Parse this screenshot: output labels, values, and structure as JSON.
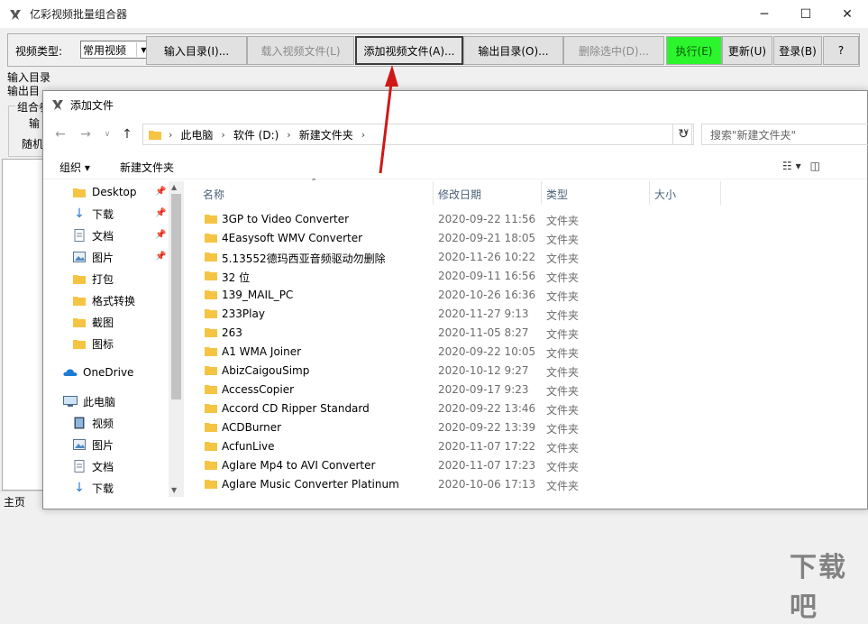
{
  "app": {
    "title": "亿彩视频批量组合器",
    "window_controls": [
      "─",
      "☐",
      "✕"
    ]
  },
  "toolbar": {
    "video_type_label": "视频类型:",
    "video_type_value": "常用视频",
    "buttons": [
      {
        "label": "输入目录(I)...",
        "state": "normal"
      },
      {
        "label": "载入视频文件(L)",
        "state": "disabled"
      },
      {
        "label": "添加视频文件(A)...",
        "state": "active"
      },
      {
        "label": "输出目录(O)...",
        "state": "normal"
      },
      {
        "label": "删除选中(D)...",
        "state": "disabled"
      },
      {
        "label": "执行(E)",
        "state": "green"
      },
      {
        "label": "更新(U)",
        "state": "normal"
      },
      {
        "label": "登录(B)",
        "state": "normal"
      },
      {
        "label": "?",
        "state": "normal"
      }
    ]
  },
  "left_panel": {
    "input_dir_label": "输入目录",
    "output_dir_label": "输出目",
    "group_title": "组合参",
    "group_line1": "输",
    "group_line2": "随机"
  },
  "status_bar": {
    "text": "主页"
  },
  "dialog": {
    "title": "添加文件",
    "breadcrumbs": [
      "此电脑",
      "软件 (D:)",
      "新建文件夹"
    ],
    "search_placeholder": "搜索\"新建文件夹\"",
    "commands": {
      "organize": "组织 ▾",
      "new_folder": "新建文件夹"
    },
    "nav_items": [
      {
        "label": "Desktop",
        "icon": "folder-icon",
        "pinned": true
      },
      {
        "label": "下载",
        "icon": "download-icon",
        "pinned": true
      },
      {
        "label": "文档",
        "icon": "document-icon",
        "pinned": true
      },
      {
        "label": "图片",
        "icon": "picture-icon",
        "pinned": true
      },
      {
        "label": "打包",
        "icon": "folder-icon",
        "pinned": false
      },
      {
        "label": "格式转换",
        "icon": "folder-icon",
        "pinned": false
      },
      {
        "label": "截图",
        "icon": "folder-icon",
        "pinned": false
      },
      {
        "label": "图标",
        "icon": "folder-icon",
        "pinned": false
      },
      {
        "label": "OneDrive",
        "icon": "cloud-icon",
        "pinned": false
      },
      {
        "label": "此电脑",
        "icon": "computer-icon",
        "pinned": false
      },
      {
        "label": "视频",
        "icon": "video-icon",
        "pinned": false
      },
      {
        "label": "图片",
        "icon": "picture-icon",
        "pinned": false
      },
      {
        "label": "文档",
        "icon": "document-icon",
        "pinned": false
      },
      {
        "label": "下载",
        "icon": "download-icon",
        "pinned": false
      }
    ],
    "columns": [
      "名称",
      "修改日期",
      "类型",
      "大小"
    ],
    "files": [
      {
        "name": "3GP to Video Converter",
        "date": "2020-09-22 11:56",
        "type": "文件夹"
      },
      {
        "name": "4Easysoft WMV Converter",
        "date": "2020-09-21 18:05",
        "type": "文件夹"
      },
      {
        "name": "5.13552德玛西亚音频驱动勿删除",
        "date": "2020-11-26 10:22",
        "type": "文件夹"
      },
      {
        "name": "32 位",
        "date": "2020-09-11 16:56",
        "type": "文件夹"
      },
      {
        "name": "139_MAIL_PC",
        "date": "2020-10-26 16:36",
        "type": "文件夹"
      },
      {
        "name": "233Play",
        "date": "2020-11-27 9:13",
        "type": "文件夹"
      },
      {
        "name": "263",
        "date": "2020-11-05 8:27",
        "type": "文件夹"
      },
      {
        "name": "A1 WMA Joiner",
        "date": "2020-09-22 10:05",
        "type": "文件夹"
      },
      {
        "name": "AbizCaigouSimp",
        "date": "2020-10-12 9:27",
        "type": "文件夹"
      },
      {
        "name": "AccessCopier",
        "date": "2020-09-17 9:23",
        "type": "文件夹"
      },
      {
        "name": "Accord CD Ripper Standard",
        "date": "2020-09-22 13:46",
        "type": "文件夹"
      },
      {
        "name": "ACDBurner",
        "date": "2020-09-22 13:39",
        "type": "文件夹"
      },
      {
        "name": "AcfunLive",
        "date": "2020-11-07 17:22",
        "type": "文件夹"
      },
      {
        "name": "Aglare Mp4 to AVI Converter",
        "date": "2020-11-07 17:23",
        "type": "文件夹"
      },
      {
        "name": "Aglare Music Converter Platinum",
        "date": "2020-10-06 17:13",
        "type": "文件夹"
      }
    ]
  },
  "watermark": "下载吧",
  "colors": {
    "folder": "#f5c443",
    "execute_green": "#2df52d",
    "annotation_arrow": "#d01818"
  }
}
